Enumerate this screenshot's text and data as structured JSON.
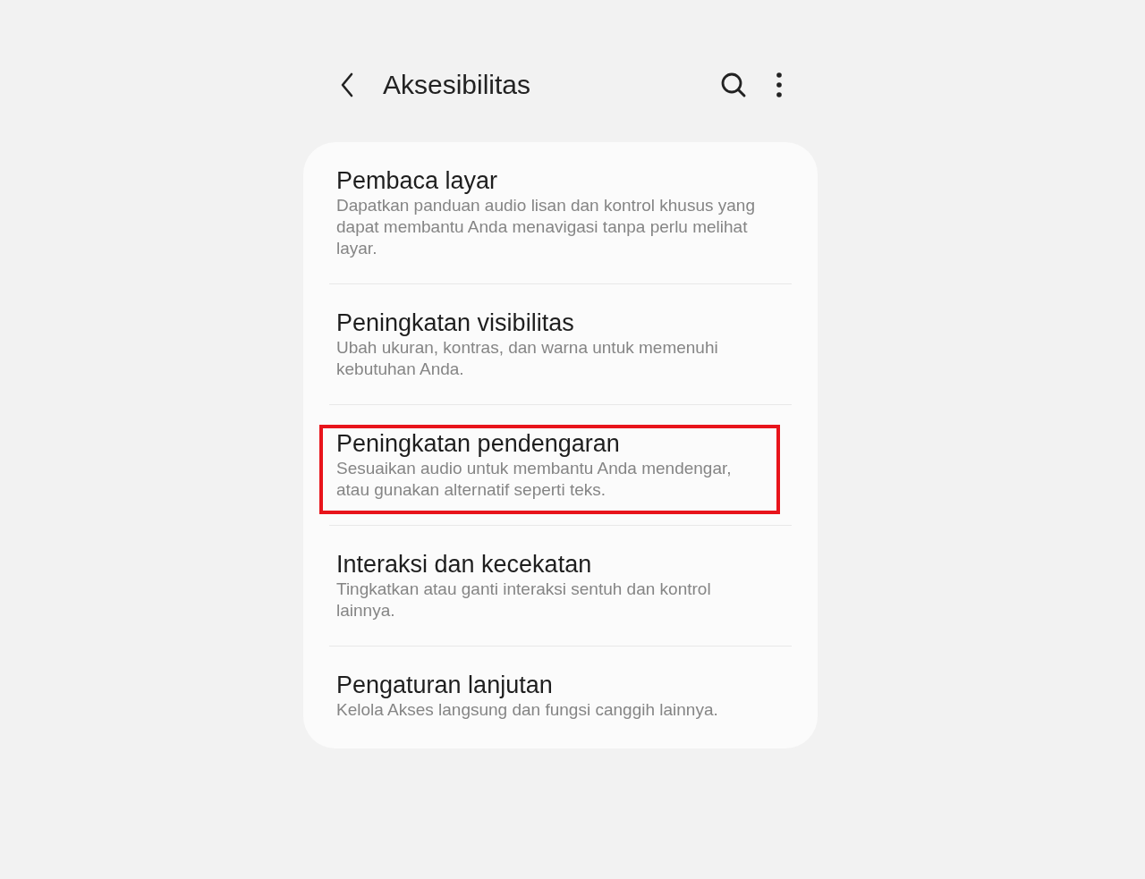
{
  "header": {
    "title": "Aksesibilitas"
  },
  "items": [
    {
      "title": "Pembaca layar",
      "description": "Dapatkan panduan audio lisan dan kontrol khusus yang dapat membantu Anda menavigasi tanpa perlu melihat layar.",
      "highlighted": false
    },
    {
      "title": "Peningkatan visibilitas",
      "description": "Ubah ukuran, kontras, dan warna untuk memenuhi kebutuhan Anda.",
      "highlighted": false
    },
    {
      "title": "Peningkatan pendengaran",
      "description": "Sesuaikan audio untuk membantu Anda mendengar, atau gunakan alternatif seperti teks.",
      "highlighted": true
    },
    {
      "title": "Interaksi dan kecekatan",
      "description": "Tingkatkan atau ganti interaksi sentuh dan kontrol lainnya.",
      "highlighted": false
    },
    {
      "title": "Pengaturan lanjutan",
      "description": "Kelola Akses langsung dan fungsi canggih lainnya.",
      "highlighted": false
    }
  ]
}
